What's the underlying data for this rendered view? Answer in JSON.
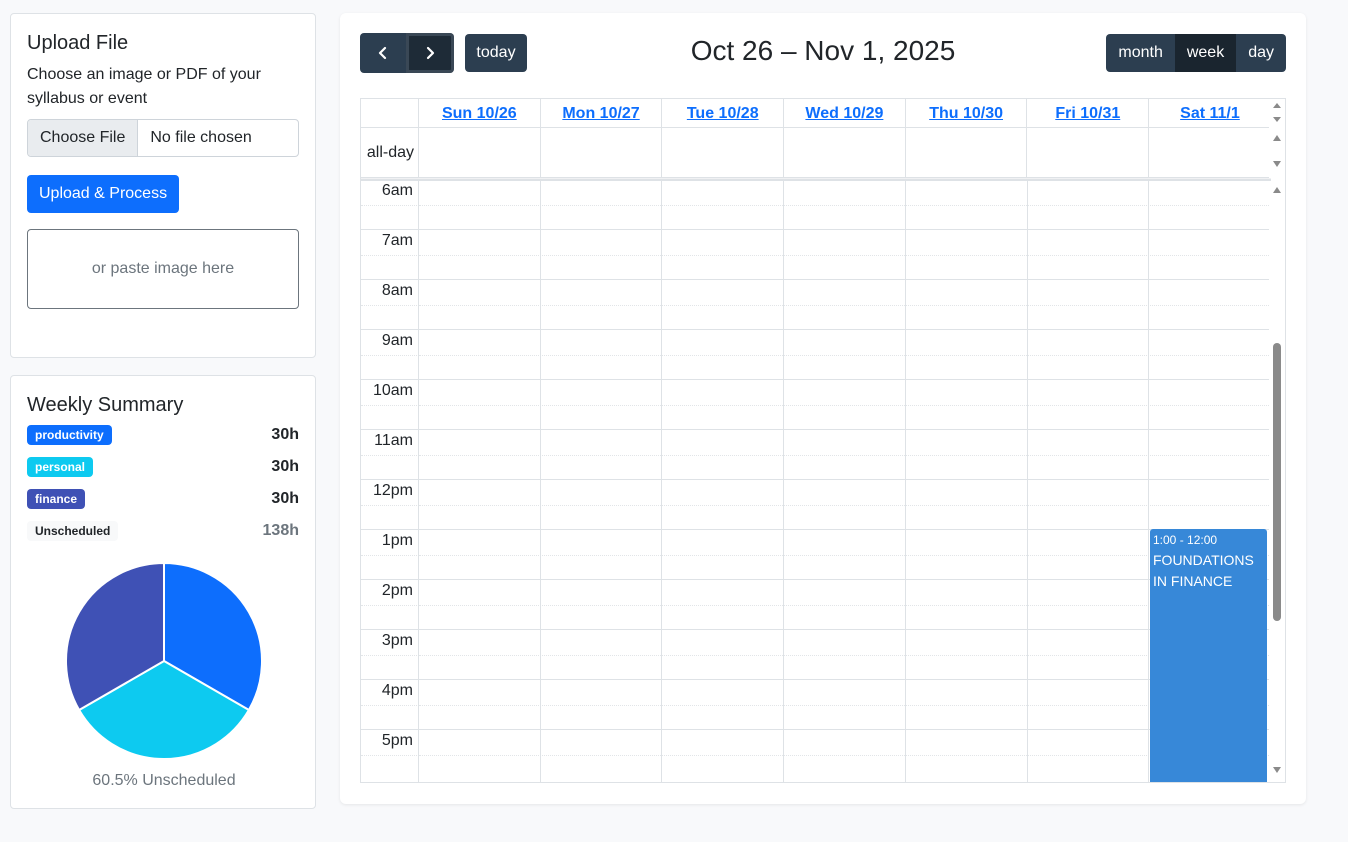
{
  "upload": {
    "title": "Upload File",
    "description": "Choose an image or PDF of your syllabus or event",
    "choose_file": "Choose File",
    "file_status": "No file chosen",
    "upload_button": "Upload & Process",
    "paste_hint": "or paste image here"
  },
  "summary": {
    "title": "Weekly Summary",
    "rows": [
      {
        "label": "productivity",
        "hours": "30h",
        "color": "#0d6efd"
      },
      {
        "label": "personal",
        "hours": "30h",
        "color": "#0dcaf0"
      },
      {
        "label": "finance",
        "hours": "30h",
        "color": "#3f51b5"
      },
      {
        "label": "Unscheduled",
        "hours": "138h",
        "color": "#f8f9fa"
      }
    ],
    "pie_caption": "60.5% Unscheduled",
    "pie_slices": [
      {
        "label": "productivity",
        "value": 30,
        "color": "#0d6efd"
      },
      {
        "label": "personal",
        "value": 30,
        "color": "#0dcaf0"
      },
      {
        "label": "finance",
        "value": 30,
        "color": "#3f51b5"
      }
    ]
  },
  "calendar": {
    "title": "Oct 26 – Nov 1, 2025",
    "prev_icon": "chevron-left-icon",
    "next_icon": "chevron-right-icon",
    "today": "today",
    "views": [
      "month",
      "week",
      "day"
    ],
    "active_view": "week",
    "days": [
      "Sun 10/26",
      "Mon 10/27",
      "Tue 10/28",
      "Wed 10/29",
      "Thu 10/30",
      "Fri 10/31",
      "Sat 11/1"
    ],
    "allday_label": "all-day",
    "times": [
      "6am",
      "7am",
      "8am",
      "9am",
      "10am",
      "11am",
      "12pm",
      "1pm",
      "2pm",
      "3pm",
      "4pm",
      "5pm"
    ],
    "event": {
      "time": "1:00 - 12:00",
      "title": "FOUNDATIONS IN FINANCE",
      "color": "#3788d8"
    }
  }
}
